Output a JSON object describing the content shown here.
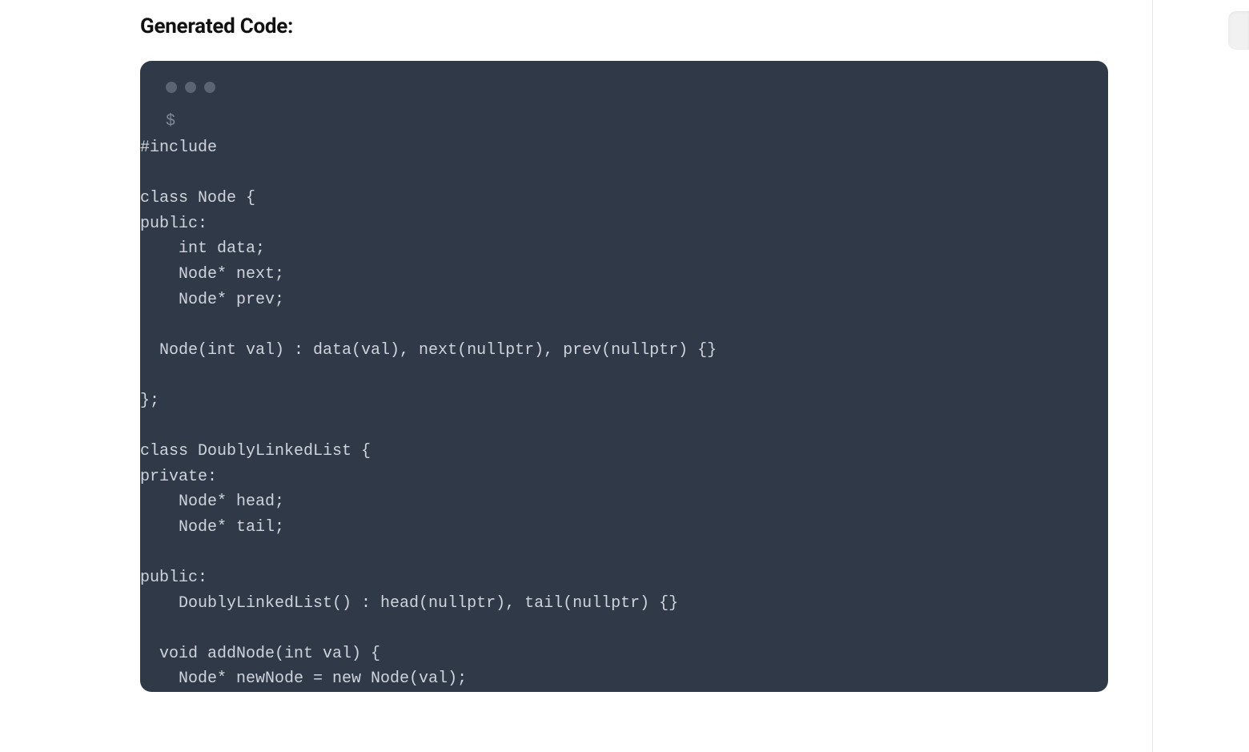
{
  "heading": "Generated Code:",
  "prompt_symbol": "$",
  "code": "#include \n\nclass Node {\npublic:\n    int data;\n    Node* next;\n    Node* prev;\n\n  Node(int val) : data(val), next(nullptr), prev(nullptr) {}\n\n};\n\nclass DoublyLinkedList {\nprivate:\n    Node* head;\n    Node* tail;\n\npublic:\n    DoublyLinkedList() : head(nullptr), tail(nullptr) {}\n\n  void addNode(int val) {\n    Node* newNode = new Node(val);",
  "colors": {
    "code_bg": "#2f3947",
    "code_text": "#cfd4dc",
    "dot": "#5a6472",
    "prompt": "#7e8896"
  }
}
